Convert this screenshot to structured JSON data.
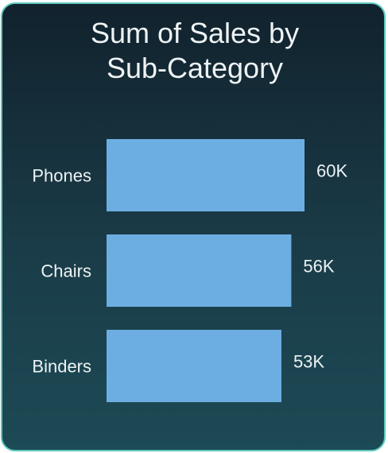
{
  "chart_data": {
    "type": "bar",
    "orientation": "horizontal",
    "title": "Sum of Sales by Sub-Category",
    "title_lines": [
      "Sum of Sales by",
      "Sub-Category"
    ],
    "categories": [
      "Phones",
      "Chairs",
      "Binders"
    ],
    "values": [
      60000,
      56000,
      53000
    ],
    "value_labels": [
      "60K",
      "56K",
      "53K"
    ],
    "xlabel": "",
    "ylabel": "",
    "xlim": [
      0,
      60000
    ],
    "grid": false,
    "bar_color": "#6daee2"
  },
  "colors": {
    "border": "#5fc8be",
    "background_top": "#11222d",
    "background_bottom": "#1c4a55",
    "text": "#eef3f4"
  }
}
